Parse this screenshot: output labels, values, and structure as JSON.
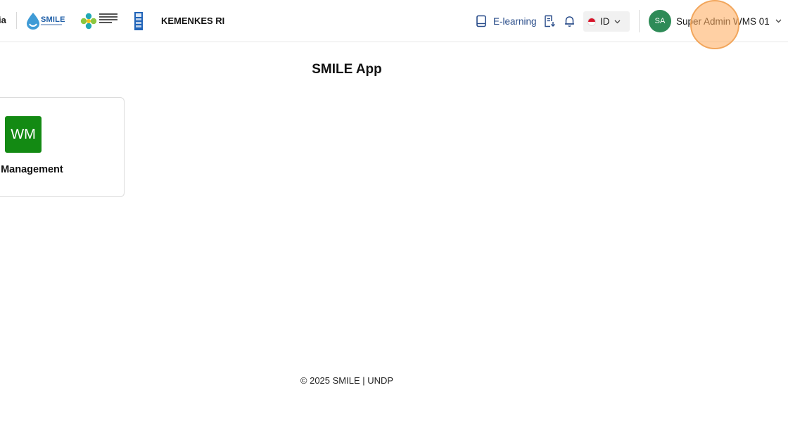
{
  "header": {
    "brand_partial": "ia",
    "smile_logo_text": "SMILE",
    "org_name": "KEMENKES RI",
    "elearning_label": "E-learning",
    "icons": [
      "book-icon",
      "document-icon",
      "bell-icon",
      "chevron-down-icon"
    ],
    "language": {
      "selected": "ID",
      "flag": "indonesia-flag-icon"
    },
    "user": {
      "initials": "SA",
      "name": "Super Admin WMS 01"
    }
  },
  "main": {
    "title": "SMILE App",
    "apps": [
      {
        "initials": "WM",
        "name": "e Management",
        "color": "#138a13"
      }
    ]
  },
  "footer": {
    "text": "© 2025 SMILE | UNDP"
  },
  "colors": {
    "accent_blue": "#2a4d8a",
    "avatar_green": "#2e8b57",
    "app_green": "#138a13"
  }
}
